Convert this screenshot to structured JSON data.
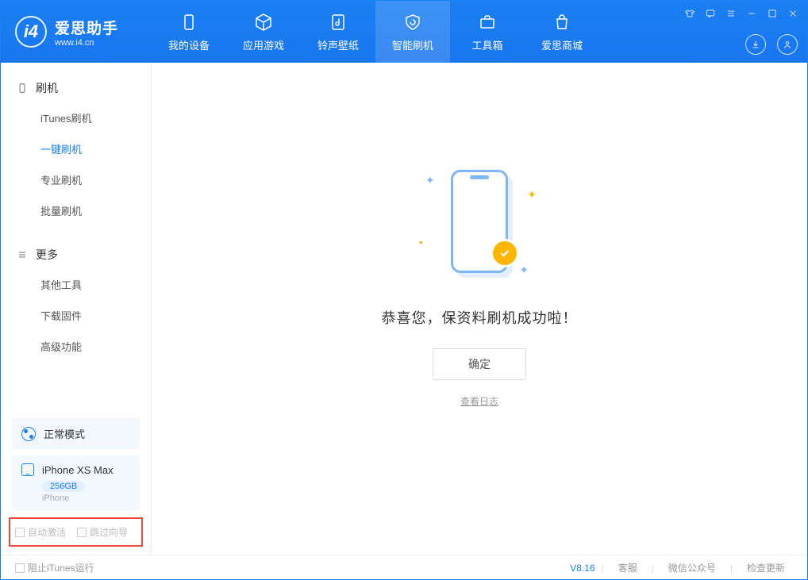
{
  "app": {
    "title": "爱思助手",
    "subtitle": "www.i4.cn"
  },
  "nav": {
    "items": [
      {
        "label": "我的设备"
      },
      {
        "label": "应用游戏"
      },
      {
        "label": "铃声壁纸"
      },
      {
        "label": "智能刷机"
      },
      {
        "label": "工具箱"
      },
      {
        "label": "爱思商城"
      }
    ]
  },
  "sidebar": {
    "section1": {
      "title": "刷机",
      "items": [
        "iTunes刷机",
        "一键刷机",
        "专业刷机",
        "批量刷机"
      ]
    },
    "section2": {
      "title": "更多",
      "items": [
        "其他工具",
        "下载固件",
        "高级功能"
      ]
    },
    "mode": "正常模式",
    "device": {
      "name": "iPhone XS Max",
      "storage": "256GB",
      "type": "iPhone"
    },
    "options": {
      "auto_activate": "自动激活",
      "skip_guide": "跳过向导"
    }
  },
  "main": {
    "success_message": "恭喜您，保资料刷机成功啦！",
    "ok_button": "确定",
    "view_log": "查看日志"
  },
  "footer": {
    "stop_itunes": "阻止iTunes运行",
    "version": "V8.16",
    "links": [
      "客服",
      "微信公众号",
      "检查更新"
    ]
  }
}
